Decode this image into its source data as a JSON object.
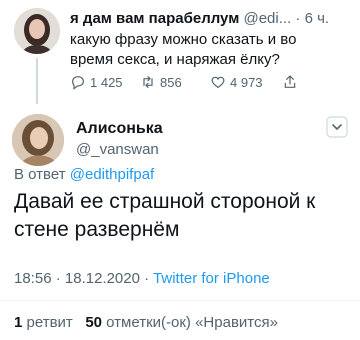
{
  "parent_tweet": {
    "name": "я дам вам парабеллум",
    "handle": "@edi...",
    "separator": "·",
    "time": "6 ч.",
    "text": "какую фразу можно сказать и во время секса, и наряжая ёлку?",
    "replies": "1 425",
    "retweets": "856",
    "likes": "4 973"
  },
  "reply_tweet": {
    "name": "Алисонька",
    "handle": "@_vanswan",
    "reply_to_label": "В ответ",
    "reply_to_handle": "@edithpifpaf",
    "text": "Давай ее страшной стороной к стене развернём",
    "time": "18:56",
    "dot1": "·",
    "date": "18.12.2020",
    "dot2": "·",
    "source": "Twitter for iPhone",
    "retweet_count": "1",
    "retweet_label": "ретвит",
    "like_count": "50",
    "like_label": "отметки(-ок) «Нравится»"
  }
}
